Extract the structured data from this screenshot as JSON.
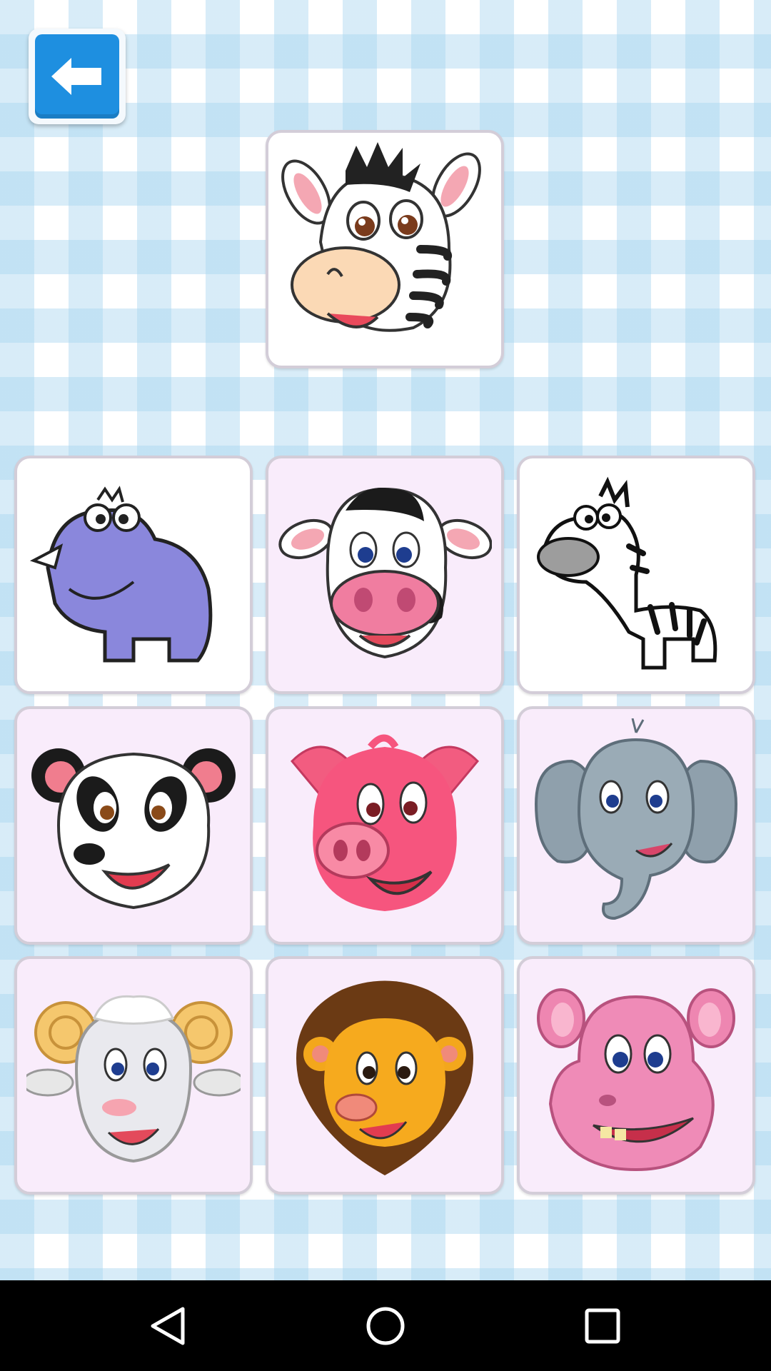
{
  "header": {
    "back_icon": "arrow-left-icon",
    "accent": "#1e8fe0"
  },
  "target": {
    "animal": "zebra-face",
    "icon": "zebra-face-icon"
  },
  "choices": [
    {
      "animal": "rhino",
      "icon": "rhino-icon"
    },
    {
      "animal": "cow",
      "icon": "cow-face-icon"
    },
    {
      "animal": "zebra",
      "icon": "zebra-icon"
    },
    {
      "animal": "panda",
      "icon": "panda-face-icon"
    },
    {
      "animal": "pig",
      "icon": "pig-face-icon"
    },
    {
      "animal": "elephant",
      "icon": "elephant-face-icon"
    },
    {
      "animal": "ram",
      "icon": "ram-face-icon"
    },
    {
      "animal": "lion",
      "icon": "lion-face-icon"
    },
    {
      "animal": "hippo",
      "icon": "hippo-face-icon"
    }
  ],
  "navbar": {
    "icons": [
      "back-triangle-icon",
      "home-circle-icon",
      "recents-square-icon"
    ]
  }
}
